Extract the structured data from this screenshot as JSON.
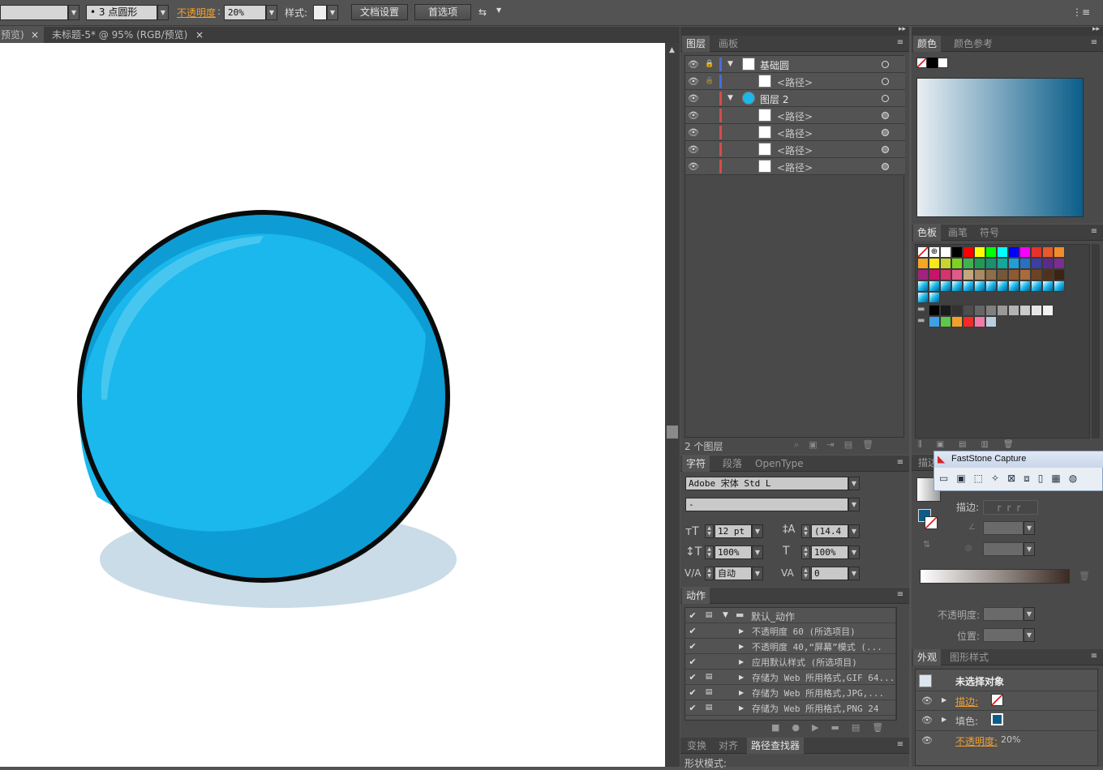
{
  "colors": {
    "accent": "#1ab8ec",
    "accent_dark": "#0e9cd4",
    "shadow": "#c9dce7",
    "fill_swatch": "#0b5e8a"
  },
  "toolbar": {
    "brush_value": "3 点圆形",
    "opacity_label": "不透明度",
    "opacity_value": "20%",
    "style_label": "样式:",
    "doc_settings": "文档设置",
    "preferences": "首选项"
  },
  "document_tabs": [
    {
      "label": "预览)",
      "close": "×"
    },
    {
      "label": "未标题-5* @ 95% (RGB/预览)",
      "close": "×"
    }
  ],
  "layers_panel": {
    "tabs": [
      "图层",
      "画板"
    ],
    "rows": [
      {
        "name": "基础圆",
        "expanded": true
      },
      {
        "name": "<路径>"
      },
      {
        "name": "图层 2",
        "expanded": true
      },
      {
        "name": "<路径>"
      },
      {
        "name": "<路径>"
      },
      {
        "name": "<路径>"
      },
      {
        "name": "<路径>"
      }
    ],
    "footer": "2 个图层"
  },
  "color_panel": {
    "tabs": [
      "颜色",
      "颜色参考"
    ]
  },
  "swatches_panel": {
    "tabs": [
      "色板",
      "画笔",
      "符号"
    ]
  },
  "character_panel": {
    "tabs": [
      "字符",
      "段落",
      "OpenType"
    ],
    "font": "Adobe 宋体 Std L",
    "style": "-",
    "size": "12 pt",
    "leading": "(14.4",
    "vscale": "100%",
    "hscale": "100%",
    "kerning": "自动",
    "tracking": "0"
  },
  "actions_panel": {
    "tab": "动作",
    "items": [
      "默认_动作",
      "不透明度 60 (所选项目)",
      "不透明度 40,“屏幕”模式 (...",
      "应用默认样式 (所选项目)",
      "存储为 Web 所用格式,GIF 64...",
      "存储为 Web 所用格式,JPG,...",
      "存储为 Web 所用格式,PNG 24"
    ]
  },
  "bottom_panel": {
    "tabs": [
      "变换",
      "对齐",
      "路径查找器"
    ],
    "shape_modes": "形状模式:"
  },
  "stroke_panel": {
    "tab": "描边",
    "stroke_label": "描边:",
    "opacity_label": "不透明度:",
    "position_label": "位置:"
  },
  "faststone": {
    "title": "FastStone Capture"
  },
  "appearance_panel": {
    "tabs": [
      "外观",
      "图形样式"
    ],
    "title": "未选择对象",
    "stroke": "描边:",
    "fill": "填色:",
    "opacity": "不透明度:",
    "opacity_value": "20%"
  }
}
